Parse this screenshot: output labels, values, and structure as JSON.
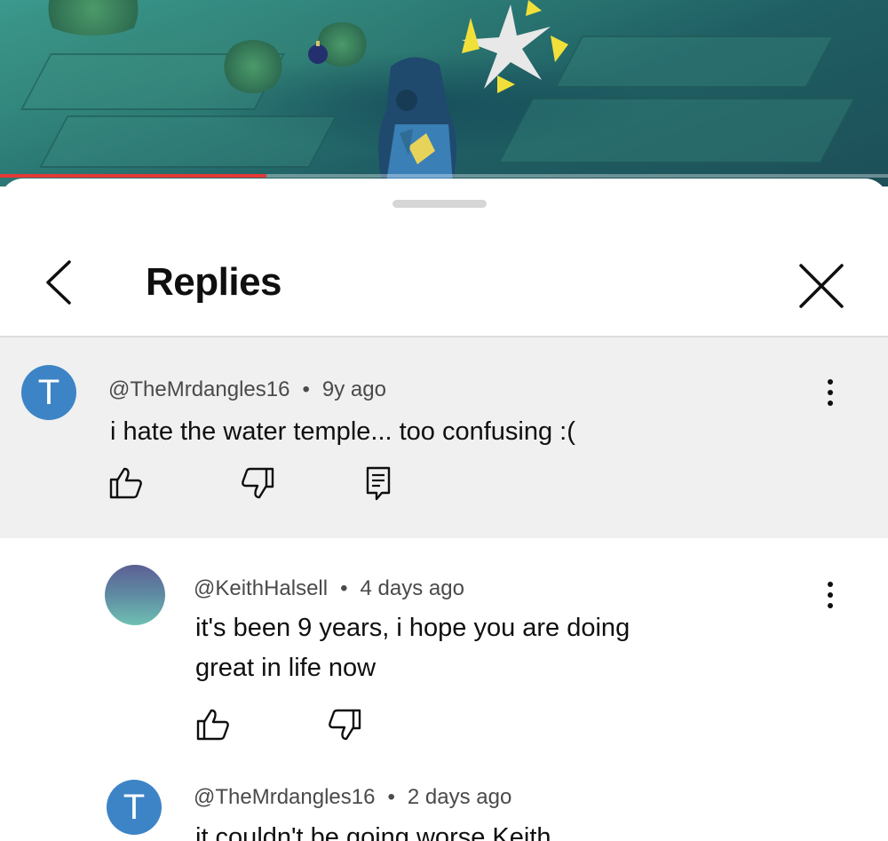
{
  "video": {
    "progress_fraction": 0.3,
    "progress_color": "#e53935"
  },
  "sheet": {
    "title": "Replies",
    "back_icon": "chevron-left-icon",
    "close_icon": "close-icon"
  },
  "comments": [
    {
      "avatar_letter": "T",
      "avatar_color": "#3d84c6",
      "author": "@TheMrdangles16",
      "separator": "•",
      "time": "9y ago",
      "text": "i hate the water temple... too confusing :(",
      "icons": [
        "thumbs-up-icon",
        "thumbs-down-icon",
        "reply-icon",
        "more-vert-icon"
      ]
    },
    {
      "avatar_letter": "",
      "author": "@KeithHalsell",
      "separator": "•",
      "time": "4 days ago",
      "text_line1": "it's been 9 years, i hope you are doing",
      "text_line2": "great in life now",
      "icons": [
        "thumbs-up-icon",
        "thumbs-down-icon",
        "more-vert-icon"
      ]
    },
    {
      "avatar_letter": "T",
      "avatar_color": "#3d84c6",
      "author": "@TheMrdangles16",
      "separator": "•",
      "time": "2 days ago",
      "text": "it couldn't be going worse Keith"
    }
  ]
}
